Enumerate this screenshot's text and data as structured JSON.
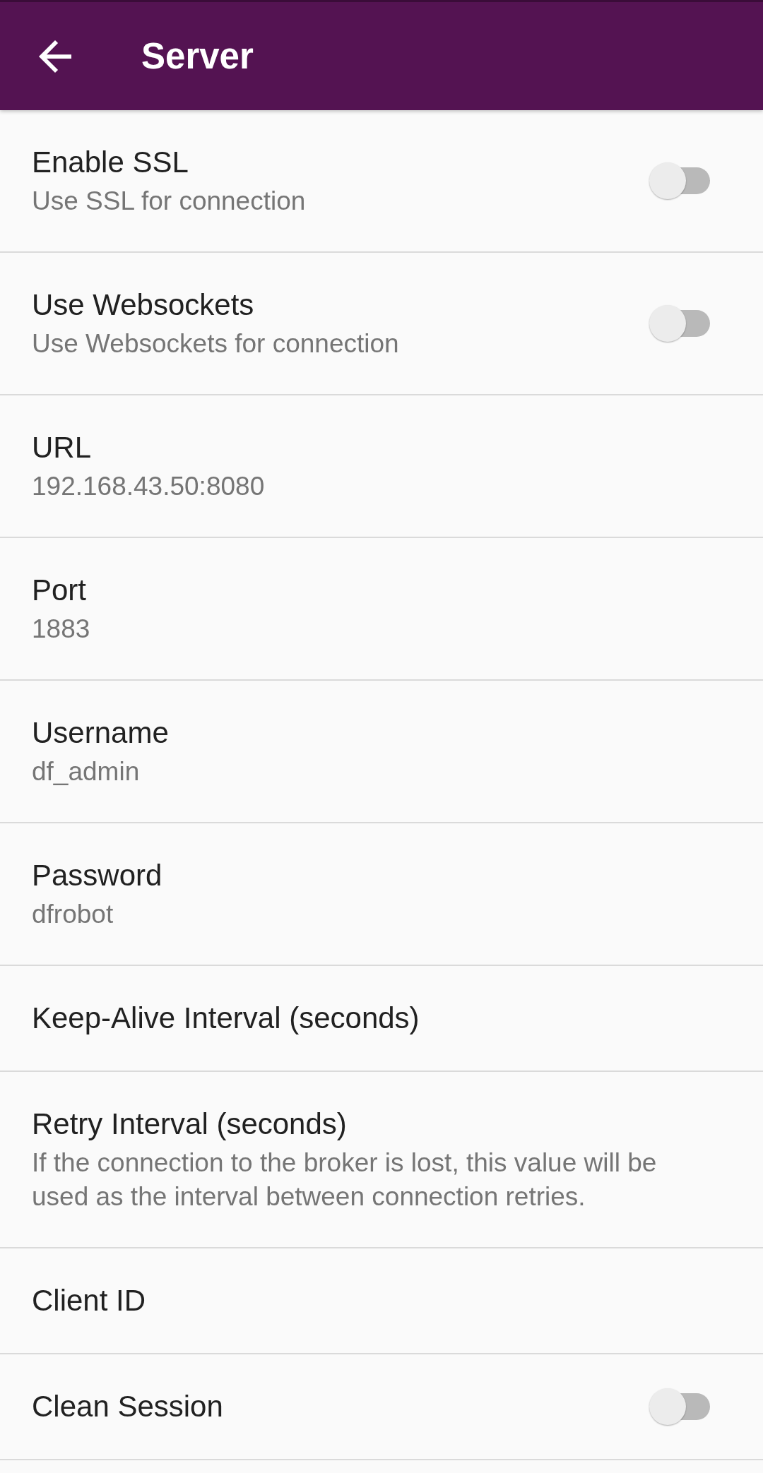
{
  "app_bar": {
    "title": "Server"
  },
  "preferences": [
    {
      "kind": "switch",
      "title": "Enable SSL",
      "summary": "Use SSL for connection",
      "on": false
    },
    {
      "kind": "switch",
      "title": "Use Websockets",
      "summary": "Use Websockets for connection",
      "on": false
    },
    {
      "kind": "text",
      "title": "URL",
      "summary": "192.168.43.50:8080"
    },
    {
      "kind": "text",
      "title": "Port",
      "summary": "1883"
    },
    {
      "kind": "text",
      "title": "Username",
      "summary": "df_admin"
    },
    {
      "kind": "text",
      "title": "Password",
      "summary": "dfrobot"
    },
    {
      "kind": "text",
      "title": "Keep-Alive Interval (seconds)"
    },
    {
      "kind": "text",
      "title": "Retry Interval (seconds)",
      "summary": "If the connection to the broker is lost, this value will be used as the interval between connection retries."
    },
    {
      "kind": "text",
      "title": "Client ID"
    },
    {
      "kind": "switch",
      "title": "Clean Session",
      "on": false
    }
  ]
}
